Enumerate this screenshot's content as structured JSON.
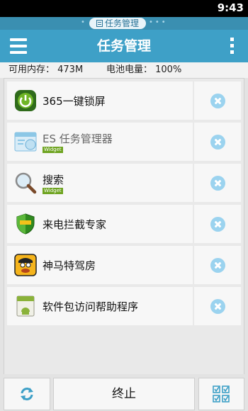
{
  "status": {
    "time": "9:43"
  },
  "tab": {
    "label": "任务管理"
  },
  "header": {
    "title": "任务管理"
  },
  "info": {
    "memory": "可用内存： 473M",
    "battery": "电池电量： 100%"
  },
  "tasks": [
    {
      "name": "365一键锁屏",
      "icon": "power-icon",
      "badge": ""
    },
    {
      "name": "ES 任务管理器",
      "icon": "es-task-manager-icon",
      "badge": "Widget"
    },
    {
      "name": "搜索",
      "icon": "magnifier-icon",
      "badge": "Widget"
    },
    {
      "name": "来电拦截专家",
      "icon": "shield-icon",
      "badge": ""
    },
    {
      "name": "神马特驾房",
      "icon": "cartoon-face-icon",
      "badge": ""
    },
    {
      "name": "软件包访问帮助程序",
      "icon": "android-package-icon",
      "badge": ""
    }
  ],
  "footer": {
    "stop_label": "终止"
  },
  "colors": {
    "titlebar": "#3ea0c7",
    "tabstrip": "#3a8fb1",
    "close": "#9bd3ef",
    "badge": "#6fa421"
  }
}
